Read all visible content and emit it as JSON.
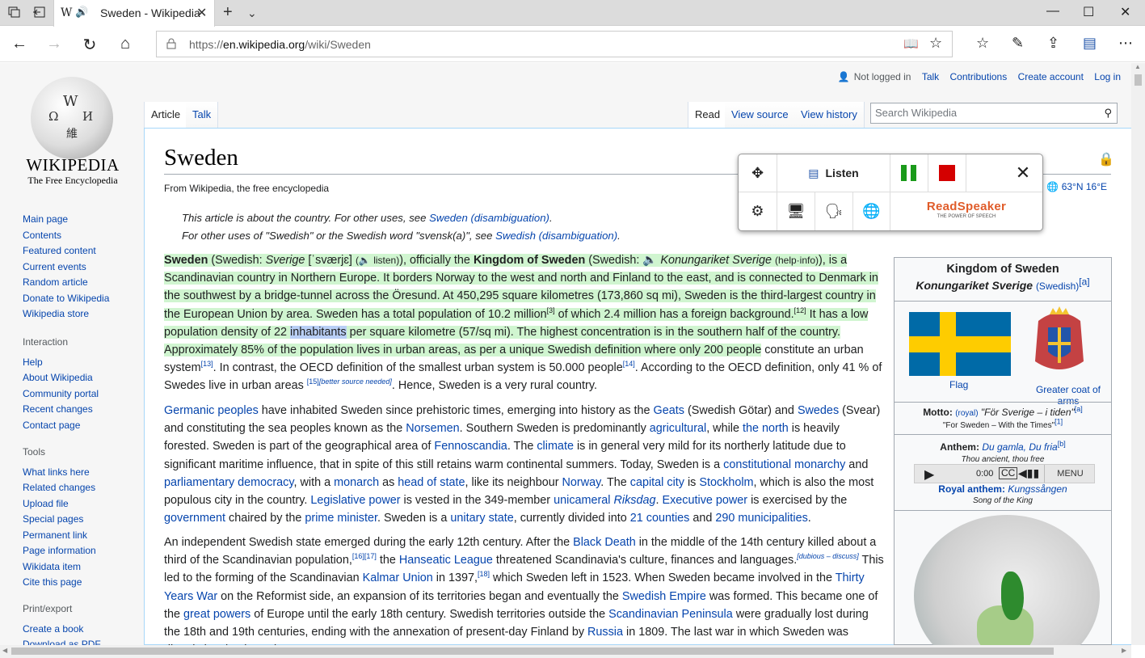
{
  "browser": {
    "tab_title": "Sweden - Wikipedia",
    "url_prefix": "https://",
    "url_host": "en.wikipedia.org",
    "url_path": "/wiki/Sweden"
  },
  "logo": {
    "wordmark": "WIKIPEDIA",
    "tagline": "The Free Encyclopedia"
  },
  "personal": [
    "Not logged in",
    "Talk",
    "Contributions",
    "Create account",
    "Log in"
  ],
  "tabs": {
    "left": [
      "Article",
      "Talk"
    ],
    "right": [
      "Read",
      "View source",
      "View history"
    ]
  },
  "search_placeholder": "Search Wikipedia",
  "sidebar": {
    "main": [
      "Main page",
      "Contents",
      "Featured content",
      "Current events",
      "Random article",
      "Donate to Wikipedia",
      "Wikipedia store"
    ],
    "interaction_title": "Interaction",
    "interaction": [
      "Help",
      "About Wikipedia",
      "Community portal",
      "Recent changes",
      "Contact page"
    ],
    "tools_title": "Tools",
    "tools": [
      "What links here",
      "Related changes",
      "Upload file",
      "Special pages",
      "Permanent link",
      "Page information",
      "Wikidata item",
      "Cite this page"
    ],
    "print_title": "Print/export",
    "print": [
      "Create a book",
      "Download as PDF"
    ]
  },
  "article": {
    "title": "Sweden",
    "sitesub": "From Wikipedia, the free encyclopedia",
    "coords": "63°N 16°E",
    "hatnote1_pre": "This article is about the country. For other uses, see ",
    "hatnote1_link": "Sweden (disambiguation)",
    "hatnote2_pre": "For other uses of \"Swedish\" or the Swedish word \"svensk(a)\", see ",
    "hatnote2_link": "Swedish (disambiguation)"
  },
  "readspeaker": {
    "listen": "Listen",
    "brand": "ReadSpeaker",
    "brand_sub": "THE POWER OF SPEECH"
  },
  "infobox": {
    "name": "Kingdom of Sweden",
    "native": "Konungariket Sverige",
    "native_lang": "(Swedish)",
    "flag_caption": "Flag",
    "coa_caption": "Greater coat of arms",
    "motto_label": "Motto:",
    "motto_royal": "(royal)",
    "motto": "\"För Sverige – i tiden\"",
    "motto_trans": "\"For Sweden – With the Times\"",
    "anthem_label": "Anthem:",
    "anthem": "Du gamla, Du fria",
    "anthem_trans": "Thou ancient, thou free",
    "time": "0:00",
    "menu": "MENU",
    "royal_label": "Royal anthem:",
    "royal": "Kungssången",
    "royal_trans": "Song of the King"
  }
}
